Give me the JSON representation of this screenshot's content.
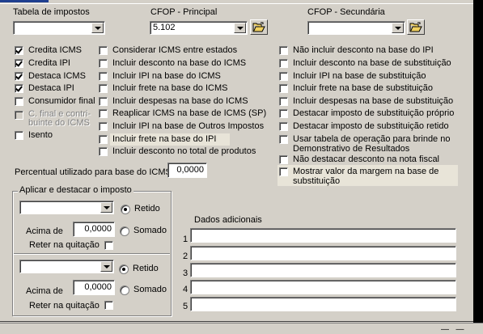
{
  "labels": {
    "tabela": "Tabela de impostos",
    "cfop_principal": "CFOP - Principal",
    "cfop_secundaria": "CFOP - Secundária",
    "percentual": "Percentual utilizado para base do ICMS",
    "aplicar_group": "Aplicar e destacar o imposto",
    "dados_adicionais": "Dados adicionais"
  },
  "combos": {
    "tabela": "",
    "cfop_principal": "5.102",
    "cfop_secundaria": "",
    "aplicar1": "",
    "aplicar2": ""
  },
  "percentual_value": "0,0000",
  "col1": [
    {
      "label": "Credita ICMS",
      "checked": true,
      "disabled": false
    },
    {
      "label": "Credita IPI",
      "checked": true,
      "disabled": false
    },
    {
      "label": "Destaca ICMS",
      "checked": true,
      "disabled": false
    },
    {
      "label": "Destaca IPI",
      "checked": true,
      "disabled": false
    },
    {
      "label": "Consumidor final",
      "checked": false,
      "disabled": false
    },
    {
      "label": "C. final e contri-",
      "label2": "buinte do ICMS",
      "checked": false,
      "disabled": true
    },
    {
      "label": "Isento",
      "checked": false,
      "disabled": false
    }
  ],
  "col2": [
    {
      "label": "Considerar ICMS entre estados",
      "checked": false
    },
    {
      "label": "Incluir desconto na base do ICMS",
      "checked": false
    },
    {
      "label": "Incluir IPI na base do ICMS",
      "checked": false
    },
    {
      "label": "Incluir frete na base do ICMS",
      "checked": false
    },
    {
      "label": "Incluir despesas na base do ICMS",
      "checked": false
    },
    {
      "label": "Reaplicar ICMS na base de ICMS (SP)",
      "checked": false
    },
    {
      "label": "Incluir IPI na base de Outros Impostos",
      "checked": false
    },
    {
      "label": "Incluir frete na base do IPI",
      "checked": false
    },
    {
      "label": "Incluir desconto no total de produtos",
      "checked": false
    }
  ],
  "col3": [
    {
      "label": "Não incluir desconto na base do IPI",
      "checked": false
    },
    {
      "label": "Incluir desconto na base de substituição",
      "checked": false
    },
    {
      "label": "Incluir IPI na base de substituição",
      "checked": false
    },
    {
      "label": "Incluir frete na base de substituição",
      "checked": false
    },
    {
      "label": "Incluir despesas na base de substituição",
      "checked": false
    },
    {
      "label": "Destacar imposto de substituição próprio",
      "checked": false
    },
    {
      "label": "Destacar imposto de substituição retido",
      "checked": false
    },
    {
      "label": "Usar tabela de operação para brinde no",
      "label2": "Demonstrativo de Resultados",
      "checked": false
    },
    {
      "label": "Não destacar desconto na nota fiscal",
      "checked": false
    },
    {
      "label": "Mostrar valor da margem na base de",
      "label2": "substituição",
      "checked": false
    }
  ],
  "aplicar1": {
    "radio_retido": "Retido",
    "radio_somado": "Somado",
    "selected": "retido",
    "acima_label": "Acima de",
    "acima_value": "0,0000",
    "reter_label": "Reter na quitação"
  },
  "aplicar2": {
    "radio_retido": "Retido",
    "radio_somado": "Somado",
    "selected": "retido",
    "acima_label": "Acima de",
    "acima_value": "0,0000",
    "reter_label": "Reter na quitação"
  },
  "dados_lines": [
    {
      "num": "1",
      "value": ""
    },
    {
      "num": "2",
      "value": ""
    },
    {
      "num": "3",
      "value": ""
    },
    {
      "num": "4",
      "value": ""
    },
    {
      "num": "5",
      "value": ""
    }
  ],
  "colors": {
    "face": "#d4d0c8",
    "accent": "#1f3f8f"
  }
}
